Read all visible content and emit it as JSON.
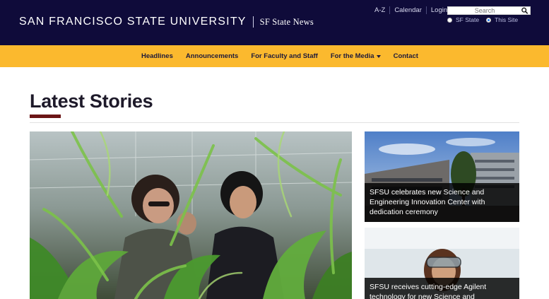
{
  "header": {
    "university": "SAN FRANCISCO STATE UNIVERSITY",
    "site_name": "SF State News",
    "util_links": [
      "A-Z",
      "Calendar",
      "Login"
    ],
    "search": {
      "placeholder": "Search"
    },
    "scope_options": [
      {
        "label": "SF State",
        "selected": false
      },
      {
        "label": "This Site",
        "selected": true
      }
    ]
  },
  "nav": {
    "items": [
      "Headlines",
      "Announcements",
      "For Faculty and Staff",
      "For the Media",
      "Contact"
    ]
  },
  "main": {
    "title": "Latest Stories",
    "stories": [
      {
        "caption": "SFSU celebrates new Science and Engineering Innovation Center with dedication ceremony"
      },
      {
        "caption": "SFSU receives cutting-edge Agilent technology for new Science and Engineering"
      }
    ]
  },
  "colors": {
    "header_bg": "#0f0b3a",
    "nav_bg": "#fbb92e",
    "accent_bar": "#6b1516"
  }
}
